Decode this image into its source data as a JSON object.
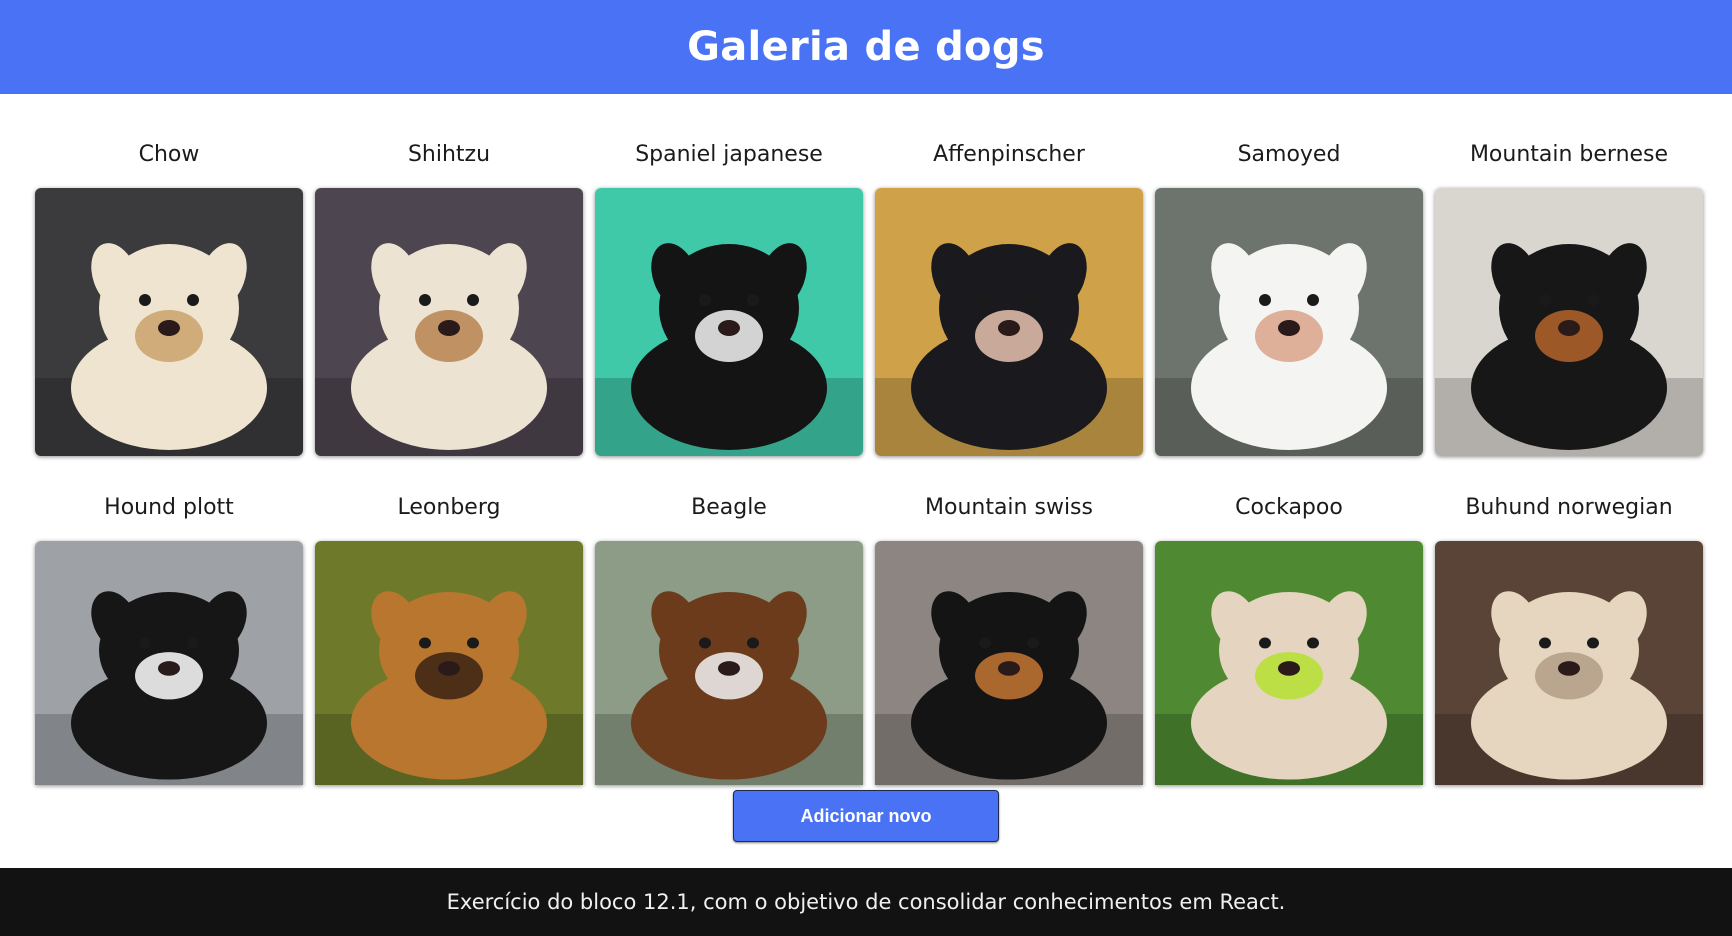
{
  "header": {
    "title": "Galeria de dogs"
  },
  "gallery": {
    "dogs": [
      {
        "name": "Chow",
        "bg": "#3b3b3d",
        "fur": "#efe4cf",
        "accent": "#c9a26a"
      },
      {
        "name": "Shihtzu",
        "bg": "#4d4550",
        "fur": "#ece3d3",
        "accent": "#b9834d"
      },
      {
        "name": "Spaniel japanese",
        "bg": "#3fc9a8",
        "fur": "#141414",
        "accent": "#f5f5f5"
      },
      {
        "name": "Affenpinscher",
        "bg": "#cfa24a",
        "fur": "#1a1a1e",
        "accent": "#e7c3b0"
      },
      {
        "name": "Samoyed",
        "bg": "#6d736d",
        "fur": "#f4f4f2",
        "accent": "#d9a28a"
      },
      {
        "name": "Mountain bernese",
        "bg": "#d9d5cf",
        "fur": "#171717",
        "accent": "#b5642a"
      },
      {
        "name": "Hound plott",
        "bg": "#9ea2a6",
        "fur": "#161616",
        "accent": "#ffffff"
      },
      {
        "name": "Leonberg",
        "bg": "#6e7a2a",
        "fur": "#b9762f",
        "accent": "#3a2212"
      },
      {
        "name": "Beagle",
        "bg": "#8c9c86",
        "fur": "#6b3b1c",
        "accent": "#f2f2f2"
      },
      {
        "name": "Mountain swiss",
        "bg": "#8c8581",
        "fur": "#141414",
        "accent": "#c67733"
      },
      {
        "name": "Cockapoo",
        "bg": "#4f8a33",
        "fur": "#e5d4bf",
        "accent": "#b4e12f"
      },
      {
        "name": "Buhund norwegian",
        "bg": "#5a4437",
        "fur": "#e6d6bf",
        "accent": "#b29c85"
      }
    ]
  },
  "actions": {
    "add_label": "Adicionar novo"
  },
  "footer": {
    "text": "Exercício do bloco 12.1, com o objetivo de consolidar conhecimentos em React."
  }
}
